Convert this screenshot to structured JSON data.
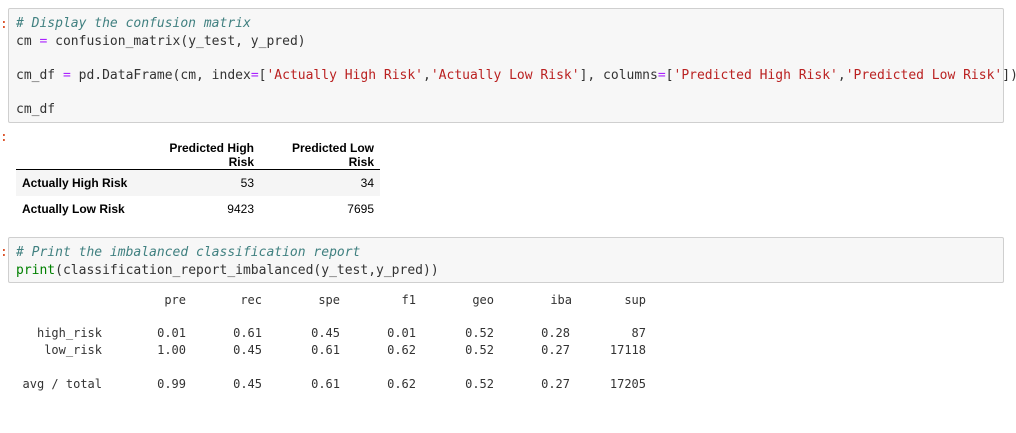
{
  "prompts": {
    "cell1_in": ":",
    "cell1_out": ":",
    "cell2_in": ":"
  },
  "cell1": {
    "line1": "# Display the confusion matrix",
    "line2a": "cm ",
    "line2b": "=",
    "line2c": " confusion_matrix(y_test, y_pred)",
    "line3a": "cm_df ",
    "line3b": "=",
    "line3c": " pd.DataFrame(cm, index",
    "line3d": "=",
    "line3e": "[",
    "line3f": "'Actually High Risk'",
    "line3g": ",",
    "line3h": "'Actually Low Risk'",
    "line3i": "], columns",
    "line3j": "=",
    "line3k": "[",
    "line3l": "'Predicted High Risk'",
    "line3m": ",",
    "line3n": "'Predicted Low Risk'",
    "line3o": "])",
    "line4": "cm_df"
  },
  "dataframe": {
    "columns": [
      "Predicted High Risk",
      "Predicted Low Risk"
    ],
    "rows": [
      {
        "index": "Actually High Risk",
        "values": [
          "53",
          "34"
        ]
      },
      {
        "index": "Actually Low Risk",
        "values": [
          "9423",
          "7695"
        ]
      }
    ]
  },
  "cell2": {
    "line1": "# Print the imbalanced classification report",
    "line2a": "print",
    "line2b": "(classification_report_imbalanced(y_test,y_pred))"
  },
  "report": {
    "headers": [
      "pre",
      "rec",
      "spe",
      "f1",
      "geo",
      "iba",
      "sup"
    ],
    "rows": [
      {
        "label": "high_risk",
        "values": [
          "0.01",
          "0.61",
          "0.45",
          "0.01",
          "0.52",
          "0.28",
          "87"
        ]
      },
      {
        "label": "low_risk",
        "values": [
          "1.00",
          "0.45",
          "0.61",
          "0.62",
          "0.52",
          "0.27",
          "17118"
        ]
      },
      {
        "label": "avg / total",
        "values": [
          "0.99",
          "0.45",
          "0.61",
          "0.62",
          "0.52",
          "0.27",
          "17205"
        ]
      }
    ]
  }
}
